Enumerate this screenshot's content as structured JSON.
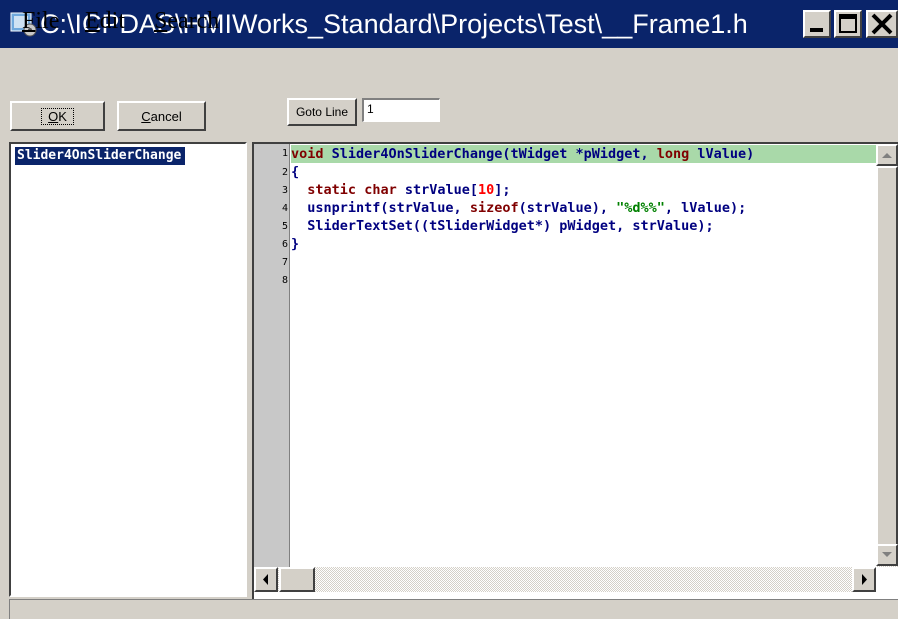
{
  "window": {
    "title": "C:\\ICPDAS\\HMIWorks_Standard\\Projects\\Test\\__Frame1.h",
    "controls": [
      "minimize-icon",
      "maximize-icon",
      "close-icon"
    ]
  },
  "menu": {
    "file": {
      "first": "F",
      "rest": "ile"
    },
    "edit": {
      "first": "E",
      "rest": "dit"
    },
    "search": {
      "first": "S",
      "rest": "earch"
    }
  },
  "toolbar": {
    "ok": {
      "first": "O",
      "rest": "K"
    },
    "cancel": {
      "first": "C",
      "rest": "ancel"
    },
    "goto_label": "Goto Line",
    "goto_value": "1"
  },
  "functions": [
    "Slider4OnSliderChange"
  ],
  "editor": {
    "line_numbers": [
      "1",
      "2",
      "3",
      "4",
      "5",
      "6",
      "7",
      "8"
    ],
    "code_lines": [
      "void Slider4OnSliderChange(tWidget *pWidget, long lValue)",
      "{",
      "  static char strValue[10];",
      "  usnprintf(strValue, sizeof(strValue), \"%d%%\", lValue);",
      "  SliderTextSet((tSliderWidget*) pWidget, strValue);",
      "}",
      "",
      ""
    ],
    "highlighted_line": 1
  },
  "colors": {
    "titlebar": "#0a246a",
    "highlight_line": "#a9d9a9",
    "keyword": "#800000",
    "identifier": "#000080",
    "number": "#ff0000",
    "string": "#008000"
  }
}
